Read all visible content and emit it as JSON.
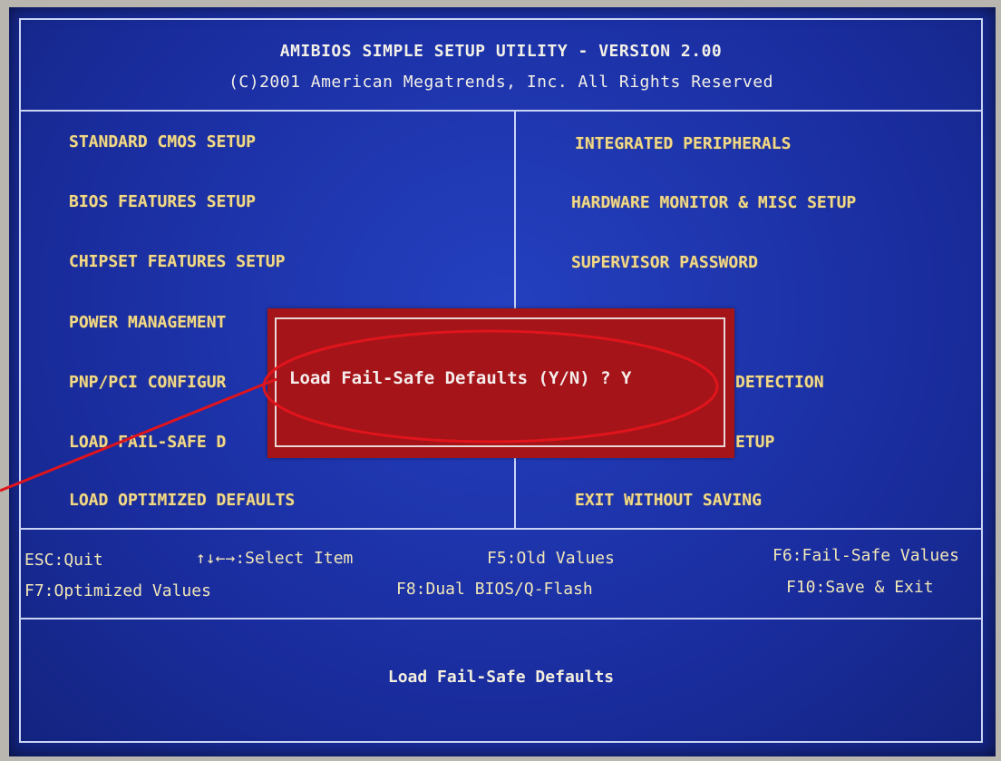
{
  "header": {
    "title": "AMIBIOS SIMPLE SETUP UTILITY - VERSION 2.00",
    "copyright": "(C)2001 American Megatrends, Inc. All Rights Reserved"
  },
  "menu": {
    "left": [
      "STANDARD CMOS SETUP",
      "BIOS FEATURES SETUP",
      "CHIPSET FEATURES SETUP",
      "POWER MANAGEMENT",
      "PNP/PCI CONFIGUR",
      "LOAD FAIL-SAFE D",
      "LOAD OPTIMIZED DEFAULTS"
    ],
    "right": [
      "INTEGRATED PERIPHERALS",
      "HARDWARE MONITOR & MISC SETUP",
      "SUPERVISOR PASSWORD",
      "DETECTION",
      "ETUP",
      "EXIT WITHOUT SAVING"
    ]
  },
  "keys": {
    "esc": "ESC:Quit",
    "select": "↑↓←→:Select Item",
    "f5": "F5:Old Values",
    "f6": "F6:Fail-Safe Values",
    "f7": "F7:Optimized Values",
    "f8": "F8:Dual BIOS/Q-Flash",
    "f10": "F10:Save & Exit"
  },
  "help_text": "Load Fail-Safe Defaults",
  "dialog": {
    "prompt": "Load Fail-Safe Defaults (Y/N) ? Y"
  },
  "colors": {
    "screen_bg": "#1b2fa6",
    "menu_text": "#f1d889",
    "dialog_bg": "#a41418",
    "annotation": "#e0141c"
  },
  "icons": {
    "annotation_arrow": "arrow-line-icon",
    "annotation_circle": "highlight-ellipse-icon"
  }
}
